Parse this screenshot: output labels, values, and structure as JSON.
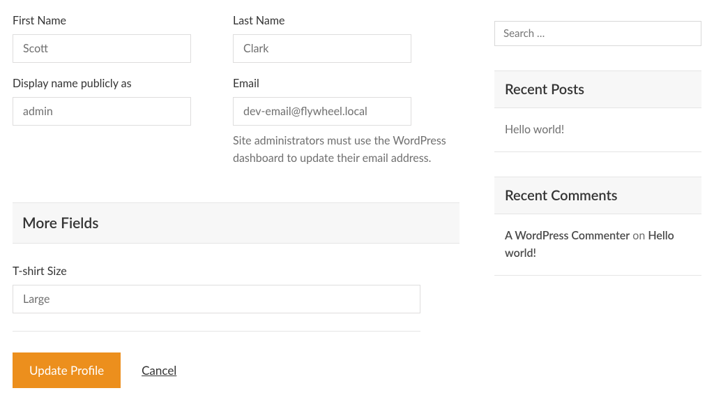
{
  "form": {
    "first_name": {
      "label": "First Name",
      "value": "Scott"
    },
    "last_name": {
      "label": "Last Name",
      "value": "Clark"
    },
    "display_name": {
      "label": "Display name publicly as",
      "value": "admin"
    },
    "email": {
      "label": "Email",
      "value": "dev-email@flywheel.local",
      "help": "Site administrators must use the WordPress dashboard to update their email address."
    },
    "more_fields_heading": "More Fields",
    "tshirt": {
      "label": "T-shirt Size",
      "value": "Large"
    },
    "submit_label": "Update Profile",
    "cancel_label": "Cancel"
  },
  "sidebar": {
    "search_placeholder": "Search …",
    "recent_posts": {
      "heading": "Recent Posts",
      "items": [
        {
          "title": "Hello world!"
        }
      ]
    },
    "recent_comments": {
      "heading": "Recent Comments",
      "items": [
        {
          "author": "A WordPress Commenter",
          "on": "on",
          "post": "Hello world!"
        }
      ]
    }
  }
}
